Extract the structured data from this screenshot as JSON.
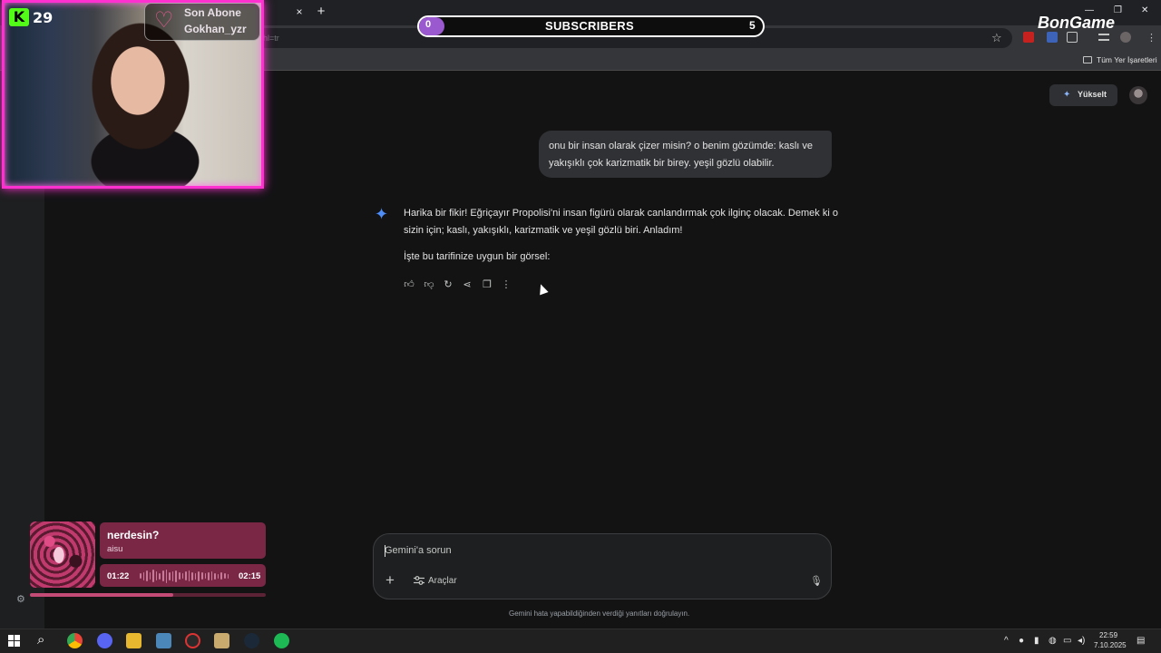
{
  "browser": {
    "tab_close_glyph": "×",
    "new_tab_glyph": "+",
    "url_fragment": "hl=tr",
    "bookmark_all_label": "Tüm Yer İşaretleri",
    "window_controls": [
      "—",
      "❐",
      "✕"
    ]
  },
  "stream": {
    "kick_badge": "K",
    "viewer_count": "29",
    "last_sub_label": "Son Abone",
    "last_sub_name": "Gokhan_yzr",
    "sub_goal_current": "0",
    "sub_goal_title": "SUBSCRIBERS",
    "sub_goal_target": "5",
    "sub_goal_progress": 0,
    "sponsor_logo": "BonGame",
    "accent_color": "#ff2fd0"
  },
  "gemini": {
    "upgrade_label": "Yükselt",
    "user_message": "onu bir insan olarak çizer misin? o benim gözümde: kaslı ve yakışıklı çok karizmatik bir birey. yeşil gözlü olabilir.",
    "response_p1": "Harika bir fikir! Eğriçayır Propolisi'ni insan figürü olarak canlandırmak çok ilginç olacak. Demek ki o sizin için; kaslı, yakışıklı, karizmatik ve yeşil gözlü biri. Anladım!",
    "response_p2": "İşte bu tarifinize uygun bir görsel:",
    "composer_placeholder": "Gemini'a sorun",
    "tools_label": "Araçlar",
    "disclaimer": "Gemini hata yapabildiğinden verdiği yanıtları doğrulayın.",
    "accent_color": "#4f8ef7"
  },
  "music": {
    "title": "nerdesin?",
    "artist": "aisu",
    "current_time": "01:22",
    "total_time": "02:15",
    "progress": 0.607
  },
  "taskbar": {
    "time": "22:59",
    "date": "7.10.2025"
  }
}
